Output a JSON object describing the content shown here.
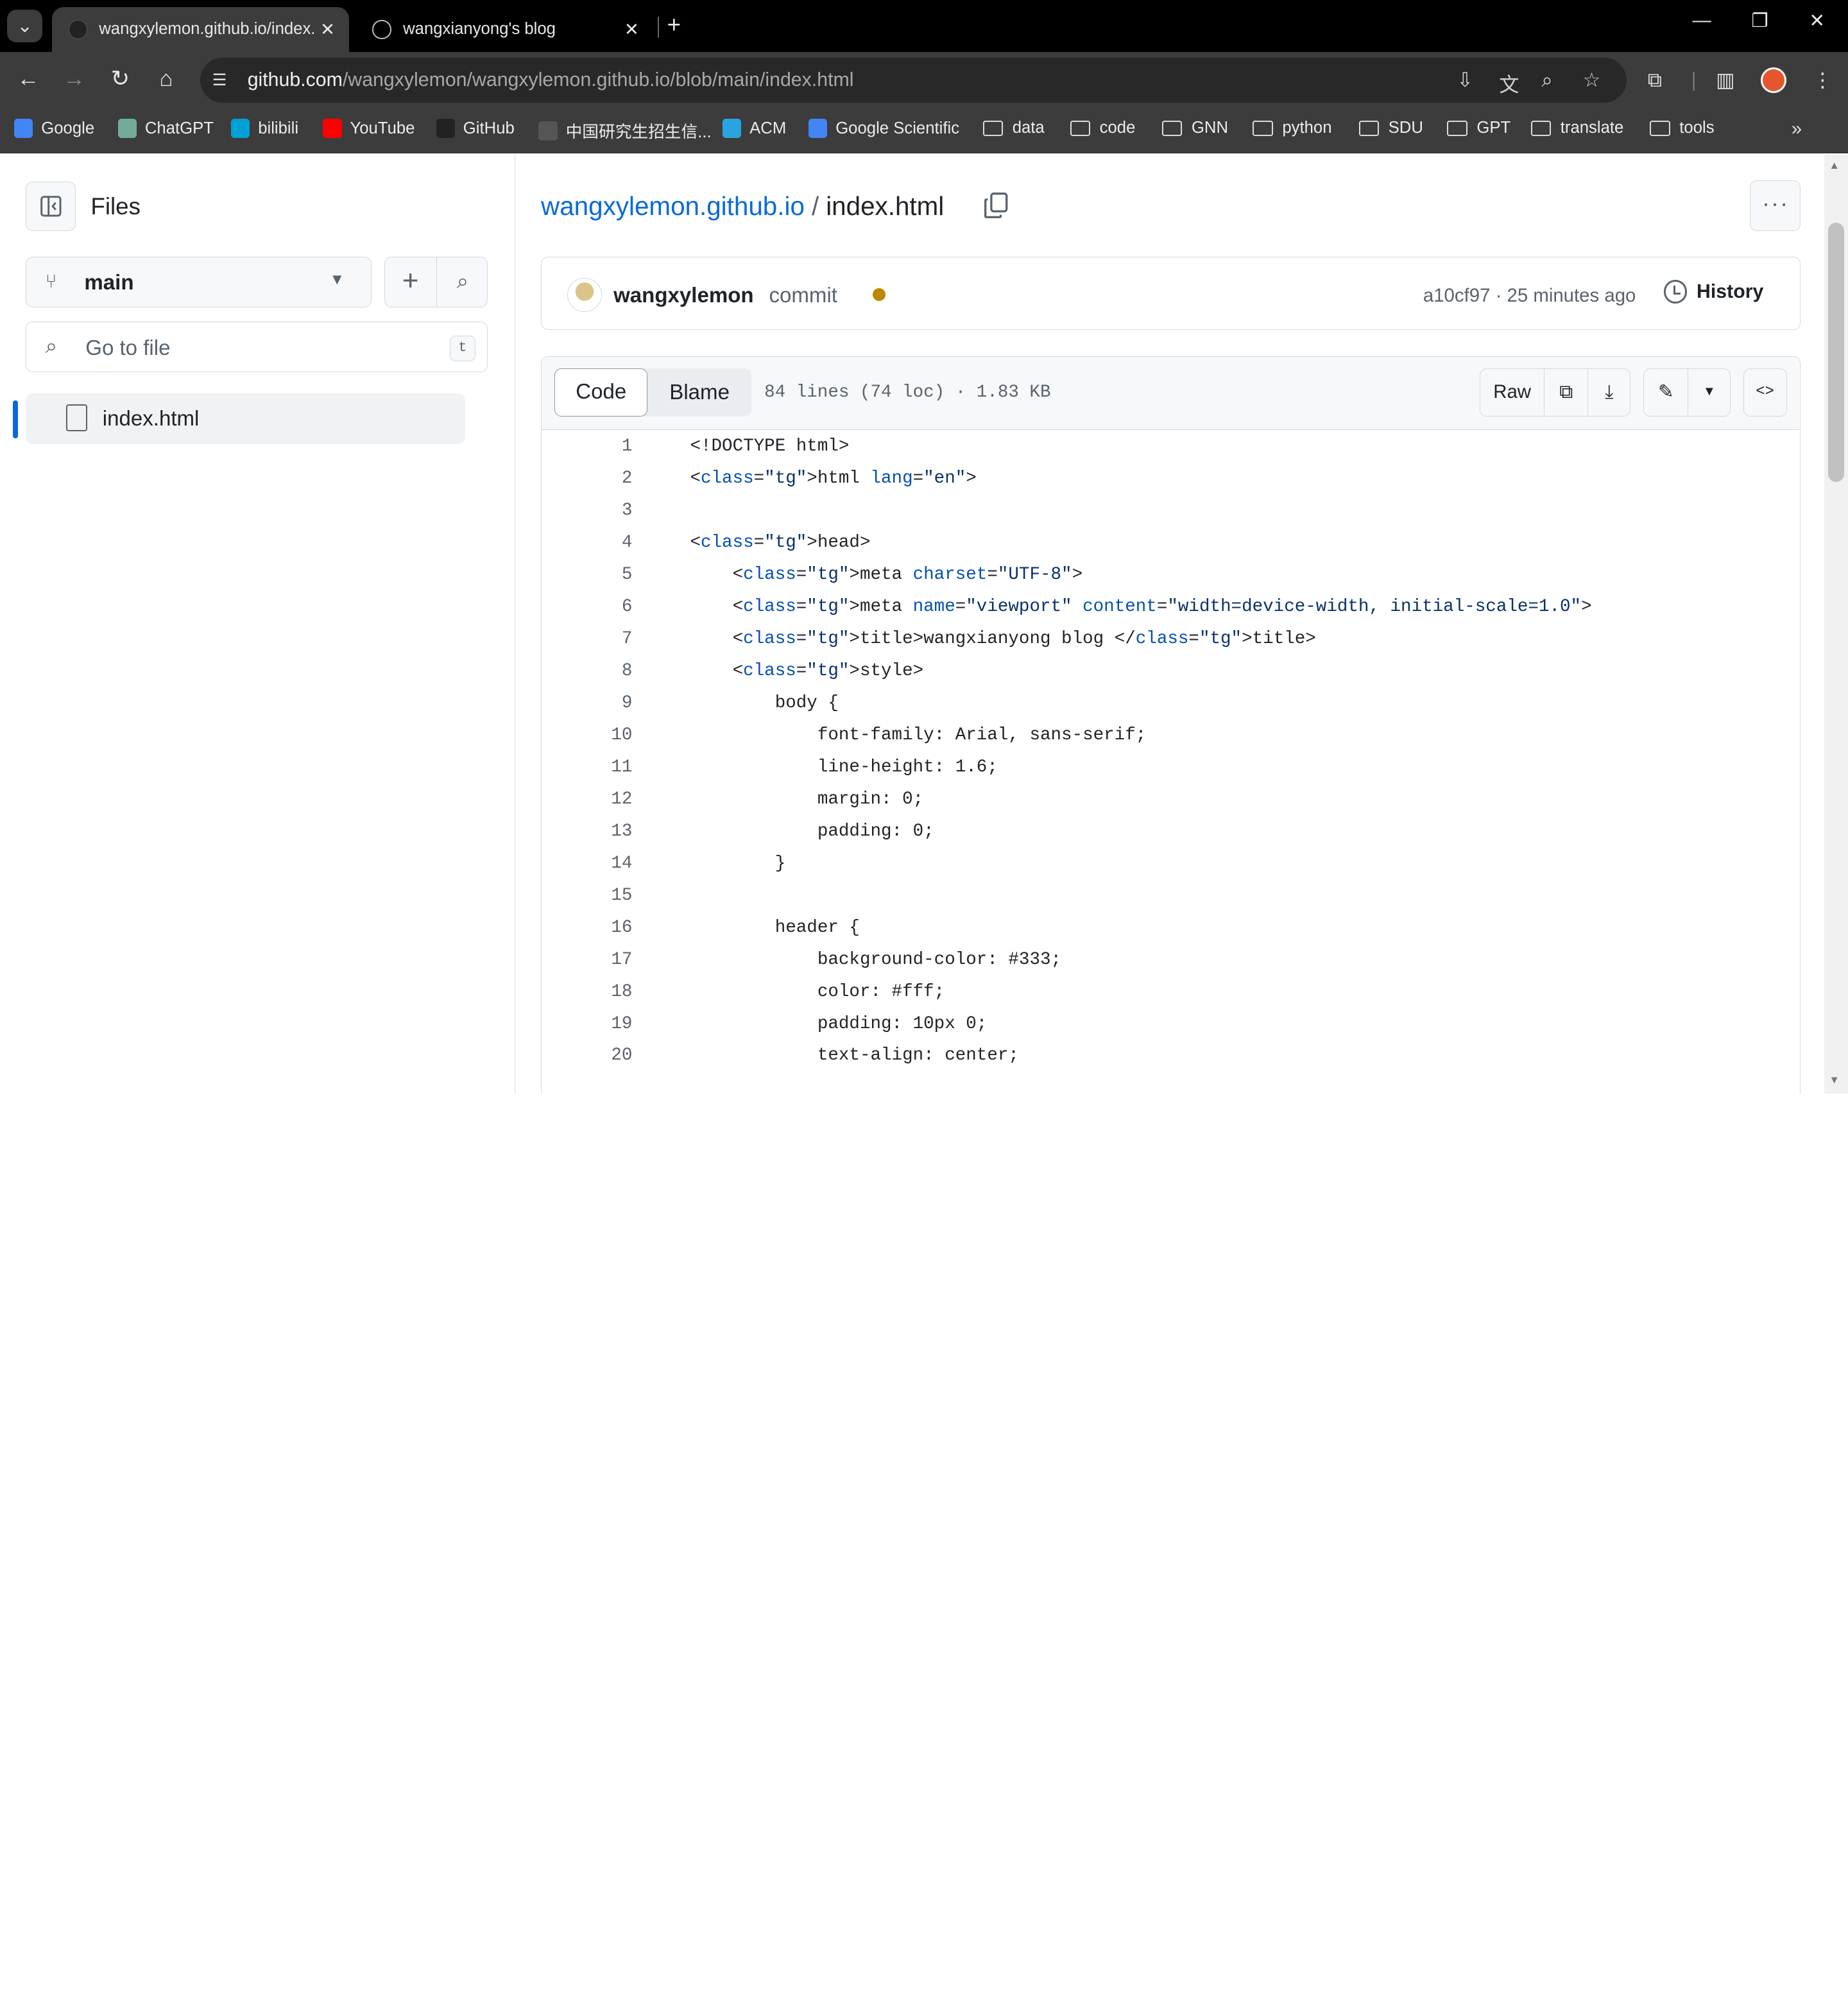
{
  "browser": {
    "tabs": [
      {
        "title": "wangxylemon.github.io/index.html",
        "active": true
      },
      {
        "title": "wangxianyong's blog",
        "active": false
      }
    ],
    "url_host": "github.com",
    "url_path": "/wangxylemon/wangxylemon.github.io/blob/main/index.html",
    "bookmarks": [
      {
        "label": "Google",
        "type": "site",
        "color": "#4285f4"
      },
      {
        "label": "ChatGPT",
        "type": "site",
        "color": "#74aa9c"
      },
      {
        "label": "bilibili",
        "type": "site",
        "color": "#00a1d6"
      },
      {
        "label": "YouTube",
        "type": "site",
        "color": "#ff0000"
      },
      {
        "label": "GitHub",
        "type": "site",
        "color": "#222222"
      },
      {
        "label": "中国研究生招生信...",
        "type": "site",
        "color": "#555555"
      },
      {
        "label": "ACM",
        "type": "site",
        "color": "#2aa4e0"
      },
      {
        "label": "Google Scientific",
        "type": "site",
        "color": "#4285f4"
      },
      {
        "label": "data",
        "type": "folder"
      },
      {
        "label": "code",
        "type": "folder"
      },
      {
        "label": "GNN",
        "type": "folder"
      },
      {
        "label": "python",
        "type": "folder"
      },
      {
        "label": "SDU",
        "type": "folder"
      },
      {
        "label": "GPT",
        "type": "folder"
      },
      {
        "label": "translate",
        "type": "folder"
      },
      {
        "label": "tools",
        "type": "folder"
      }
    ]
  },
  "sidebar": {
    "title": "Files",
    "branch": "main",
    "search_placeholder": "Go to file",
    "search_shortcut": "t",
    "files": [
      "index.html"
    ]
  },
  "file": {
    "repo": "wangxylemon.github.io",
    "separator": "/",
    "name": "index.html",
    "commit_author": "wangxylemon",
    "commit_message": "commit",
    "commit_meta": "a10cf97 · 25 minutes ago",
    "history_label": "History",
    "tab_code": "Code",
    "tab_blame": "Blame",
    "info": "84 lines (74 loc) · 1.83 KB",
    "raw_label": "Raw",
    "status_color": "#bf8700"
  },
  "code_lines": [
    {
      "n": "1",
      "text": "<!DOCTYPE html>"
    },
    {
      "n": "2",
      "text": "<html lang=\"en\">"
    },
    {
      "n": "3",
      "text": ""
    },
    {
      "n": "4",
      "text": "<head>"
    },
    {
      "n": "5",
      "text": "    <meta charset=\"UTF-8\">"
    },
    {
      "n": "6",
      "text": "    <meta name=\"viewport\" content=\"width=device-width, initial-scale=1.0\">"
    },
    {
      "n": "7",
      "text": "    <title>wangxianyong blog </title>"
    },
    {
      "n": "8",
      "text": "    <style>"
    },
    {
      "n": "9",
      "text": "        body {"
    },
    {
      "n": "10",
      "text": "            font-family: Arial, sans-serif;"
    },
    {
      "n": "11",
      "text": "            line-height: 1.6;"
    },
    {
      "n": "12",
      "text": "            margin: 0;"
    },
    {
      "n": "13",
      "text": "            padding: 0;"
    },
    {
      "n": "14",
      "text": "        }"
    },
    {
      "n": "15",
      "text": ""
    },
    {
      "n": "16",
      "text": "        header {"
    },
    {
      "n": "17",
      "text": "            background-color: #333;"
    },
    {
      "n": "18",
      "text": "            color: #fff;"
    },
    {
      "n": "19",
      "text": "            padding: 10px 0;"
    },
    {
      "n": "20",
      "text": "            text-align: center;"
    }
  ]
}
